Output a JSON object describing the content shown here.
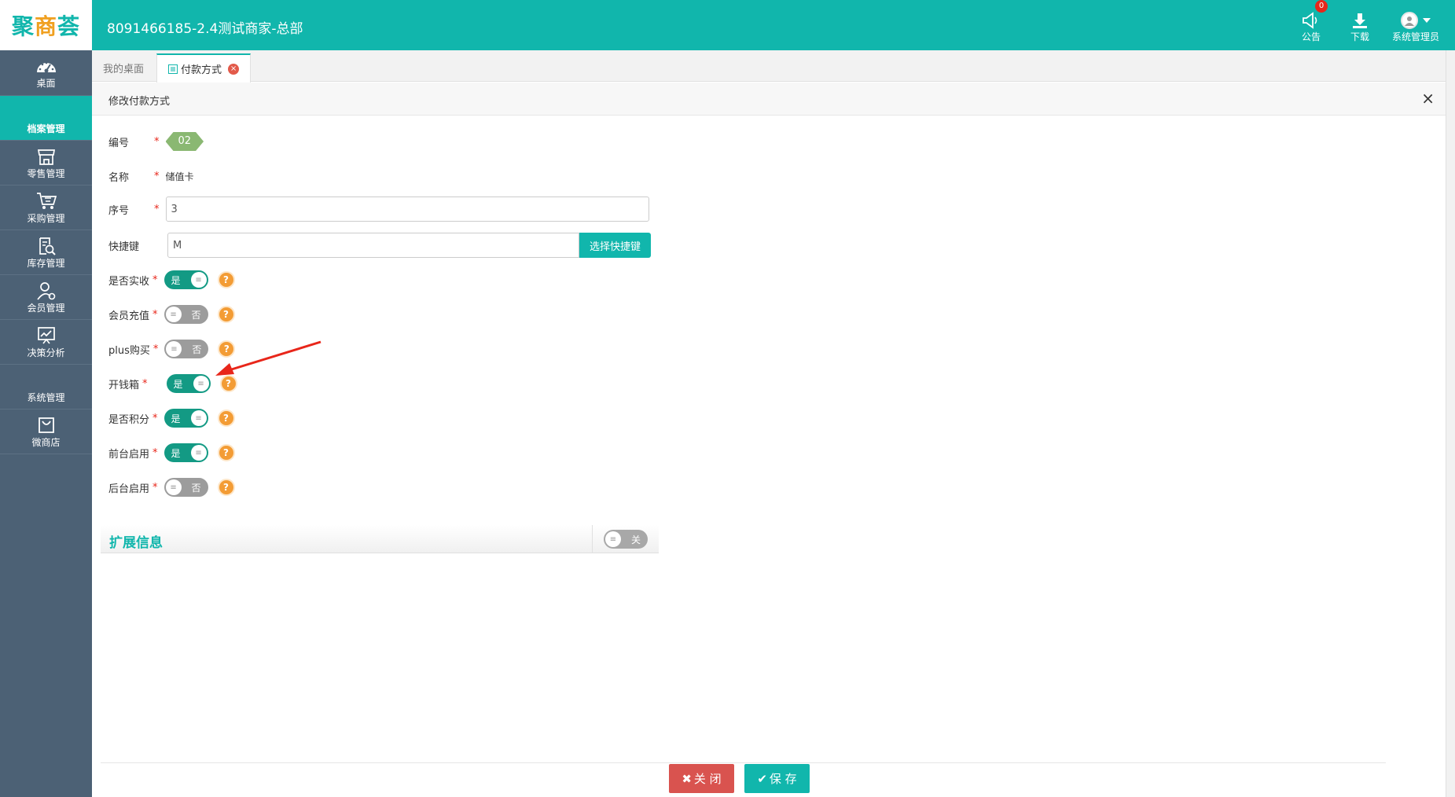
{
  "header": {
    "logo_main": "聚",
    "logo_accent": "商",
    "logo_end": "荟",
    "store_title": "8091466185-2.4测试商家-总部",
    "notice_label": "公告",
    "notice_badge": "0",
    "download_label": "下载",
    "user_label": "系统管理员"
  },
  "sidebar": {
    "dashboard": "桌面",
    "archive_heading": "档案管理",
    "items": [
      {
        "label": "零售管理",
        "icon": "store-icon"
      },
      {
        "label": "采购管理",
        "icon": "cart-icon"
      },
      {
        "label": "库存管理",
        "icon": "inventory-search-icon"
      },
      {
        "label": "会员管理",
        "icon": "member-icon"
      },
      {
        "label": "决策分析",
        "icon": "chart-icon"
      }
    ],
    "system_heading": "系统管理",
    "micro_shop": "微商店"
  },
  "tabs": [
    {
      "label": "我的桌面"
    },
    {
      "label": "付款方式"
    }
  ],
  "modal": {
    "title": "修改付款方式",
    "close_glyph": "×"
  },
  "form": {
    "id_label": "编号",
    "id_value": "02",
    "name_label": "名称",
    "name_value": "储值卡",
    "order_label": "序号",
    "order_value": "3",
    "hotkey_label": "快捷键",
    "hotkey_value": "M",
    "hotkey_button": "选择快捷键",
    "toggles": [
      {
        "label": "是否实收",
        "on": true,
        "text": "是"
      },
      {
        "label": "会员充值",
        "on": false,
        "text": "否"
      },
      {
        "label": "plus购买",
        "on": false,
        "text": "否"
      },
      {
        "label": "开钱箱",
        "on": true,
        "text": "是"
      },
      {
        "label": "是否积分",
        "on": true,
        "text": "是"
      },
      {
        "label": "前台启用",
        "on": true,
        "text": "是"
      },
      {
        "label": "后台启用",
        "on": false,
        "text": "否"
      }
    ],
    "required_mark": "*",
    "help_glyph": "?"
  },
  "extension": {
    "title": "扩展信息",
    "toggle_text": "关"
  },
  "footer": {
    "close_label": "关 闭",
    "save_label": "保 存"
  },
  "colors": {
    "primary": "#11b6ac",
    "sidebar": "#4c6175",
    "toggle_on": "#139a84",
    "danger": "#d9534f",
    "help": "#f39c35"
  }
}
